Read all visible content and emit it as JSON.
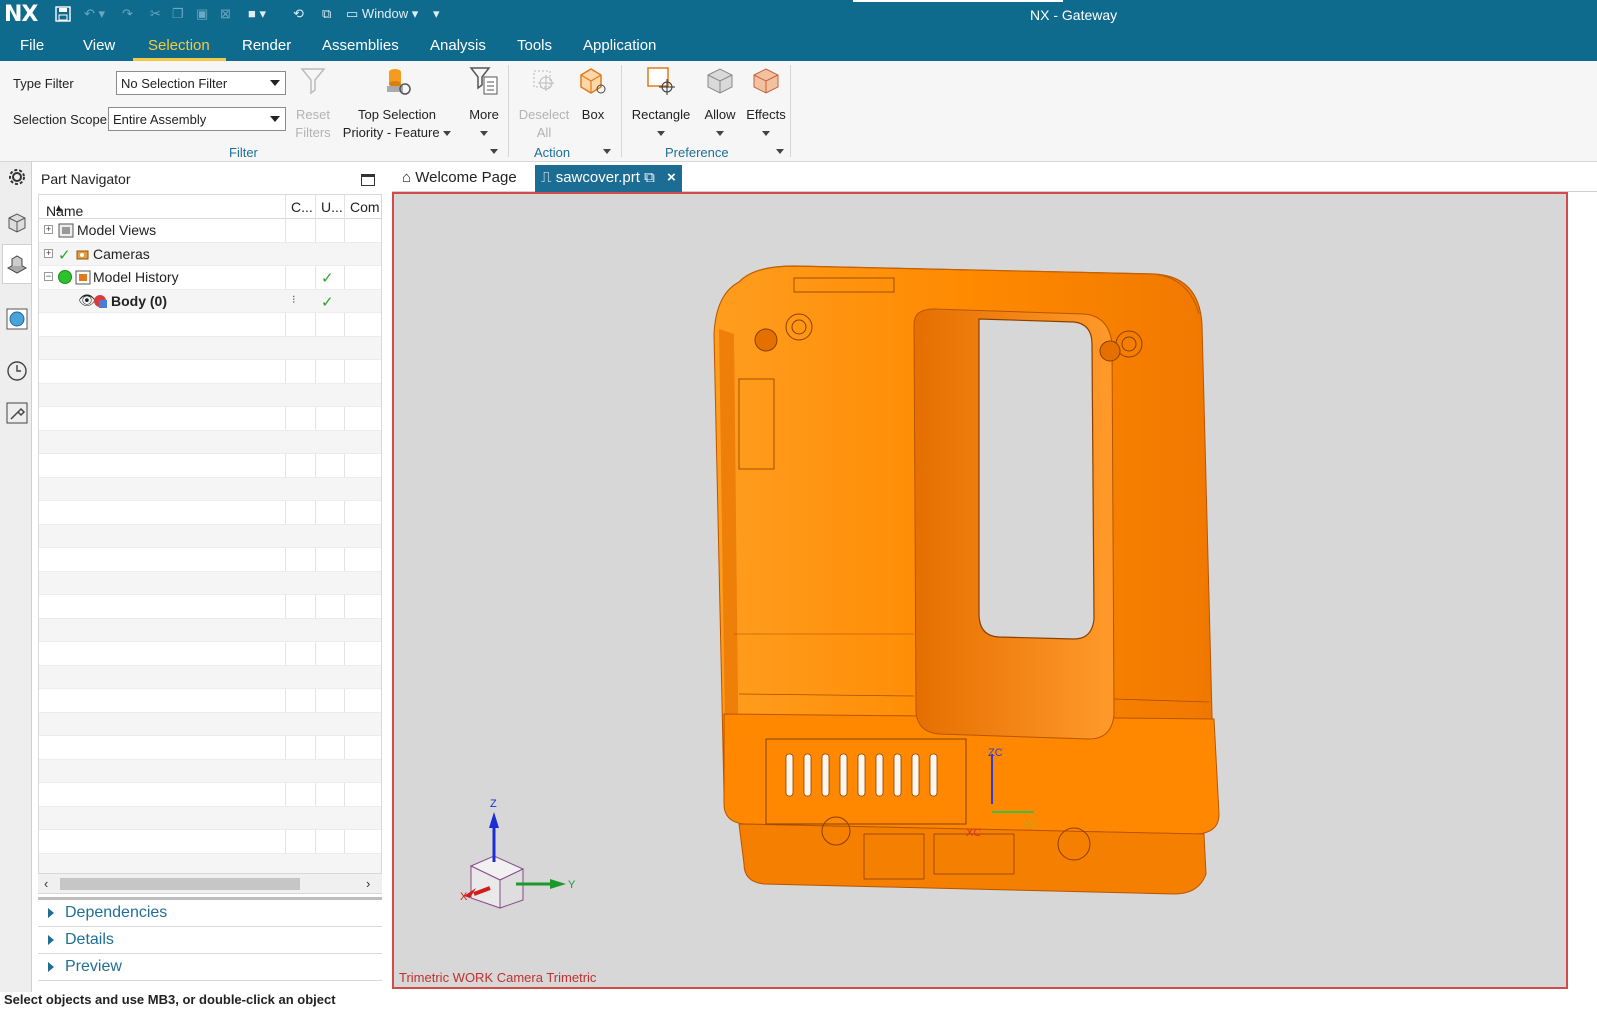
{
  "app": {
    "logo": "NX",
    "title": "NX - Gateway",
    "window_menu_label": "Window"
  },
  "menu": {
    "items": [
      "File",
      "View",
      "Selection",
      "Render",
      "Assemblies",
      "Analysis",
      "Tools",
      "Application"
    ],
    "active": "Selection"
  },
  "ribbon": {
    "type_filter_label": "Type Filter",
    "type_filter_value": "No Selection Filter",
    "scope_label": "Selection Scope",
    "scope_value": "Entire Assembly",
    "reset_filters_line1": "Reset",
    "reset_filters_line2": "Filters",
    "top_selection_line1": "Top Selection",
    "top_selection_line2": "Priority - Feature",
    "more": "More",
    "deselect_line1": "Deselect",
    "deselect_line2": "All",
    "box": "Box",
    "rectangle": "Rectangle",
    "allow": "Allow",
    "effects": "Effects",
    "groups": {
      "filter": "Filter",
      "action": "Action",
      "preference": "Preference"
    }
  },
  "navigator": {
    "title": "Part Navigator",
    "columns": [
      "Name",
      "C...",
      "U...",
      "Com"
    ],
    "rows": [
      {
        "label": "Model Views",
        "bold": false
      },
      {
        "label": "Cameras",
        "bold": false
      },
      {
        "label": "Model History",
        "bold": false
      },
      {
        "label": "Body (0)",
        "bold": true
      }
    ],
    "panels": [
      "Dependencies",
      "Details",
      "Preview"
    ]
  },
  "tabs": {
    "welcome": "Welcome Page",
    "active_file": "sawcover.prt"
  },
  "viewport": {
    "view_label": "Trimetric WORK Camera Trimetric",
    "triad": {
      "z": "Z",
      "y": "Y",
      "x": "X"
    },
    "wcs": {
      "zc": "ZC",
      "xc": "XC",
      "yc": "YC"
    },
    "model_color": "#ff8c00",
    "background": "#d7d7d7"
  },
  "status": {
    "prompt": "Select objects and use MB3, or double-click an object"
  }
}
